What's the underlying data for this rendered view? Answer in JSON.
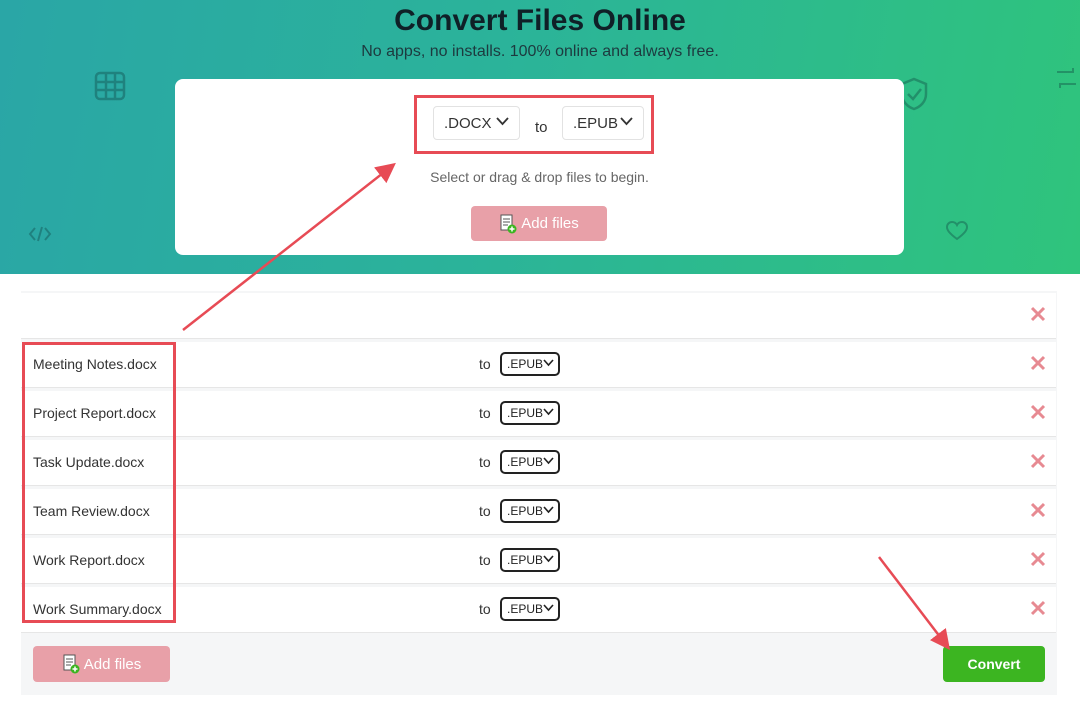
{
  "header": {
    "title": "Convert Files Online",
    "subtitle": "No apps, no installs. 100% online and always free."
  },
  "converter": {
    "from_format": ".DOCX",
    "to_label": "to",
    "to_format": ".EPUB",
    "hint": "Select or drag & drop files to begin.",
    "add_files_label": "Add files"
  },
  "file_list": {
    "to_label": "to",
    "files": [
      {
        "name": "Meeting Notes.docx",
        "target": ".EPUB"
      },
      {
        "name": "Project Report.docx",
        "target": ".EPUB"
      },
      {
        "name": "Task Update.docx",
        "target": ".EPUB"
      },
      {
        "name": "Team Review.docx",
        "target": ".EPUB"
      },
      {
        "name": "Work Report.docx",
        "target": ".EPUB"
      },
      {
        "name": "Work Summary.docx",
        "target": ".EPUB"
      }
    ]
  },
  "footer": {
    "add_files_label": "Add files",
    "convert_label": "Convert"
  },
  "colors": {
    "hero_gradient": [
      "#2aa6a6",
      "#2fc47c"
    ],
    "add_files_button": "#e8a0a8",
    "convert_button": "#3cb521",
    "remove_icon": "#e78a92",
    "annotation": "#e74b55"
  }
}
